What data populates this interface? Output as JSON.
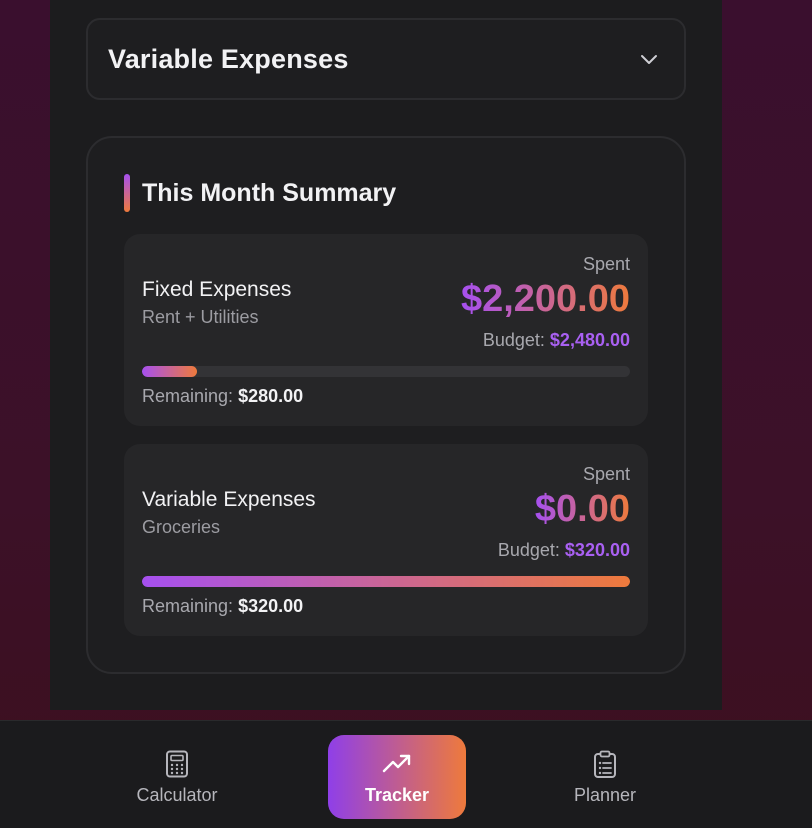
{
  "accordion": {
    "title": "Variable Expenses"
  },
  "summary": {
    "title": "This Month Summary",
    "cards": [
      {
        "name": "Fixed Expenses",
        "subtitle": "Rent + Utilities",
        "spent_label": "Spent",
        "spent": "$2,200.00",
        "budget_label": "Budget:",
        "budget": "$2,480.00",
        "remaining_label": "Remaining:",
        "remaining": "$280.00",
        "progress_fraction": 0.113
      },
      {
        "name": "Variable Expenses",
        "subtitle": "Groceries",
        "spent_label": "Spent",
        "spent": "$0.00",
        "budget_label": "Budget:",
        "budget": "$320.00",
        "remaining_label": "Remaining:",
        "remaining": "$320.00",
        "progress_fraction": 1.0
      }
    ]
  },
  "nav": {
    "items": [
      {
        "label": "Calculator",
        "icon": "calculator-icon",
        "active": false
      },
      {
        "label": "Tracker",
        "icon": "trending-up-icon",
        "active": true
      },
      {
        "label": "Planner",
        "icon": "clipboard-list-icon",
        "active": false
      }
    ]
  },
  "colors": {
    "accent_start": "#a650f0",
    "accent_end": "#ee7a3c",
    "budget_text": "#a960f2"
  }
}
